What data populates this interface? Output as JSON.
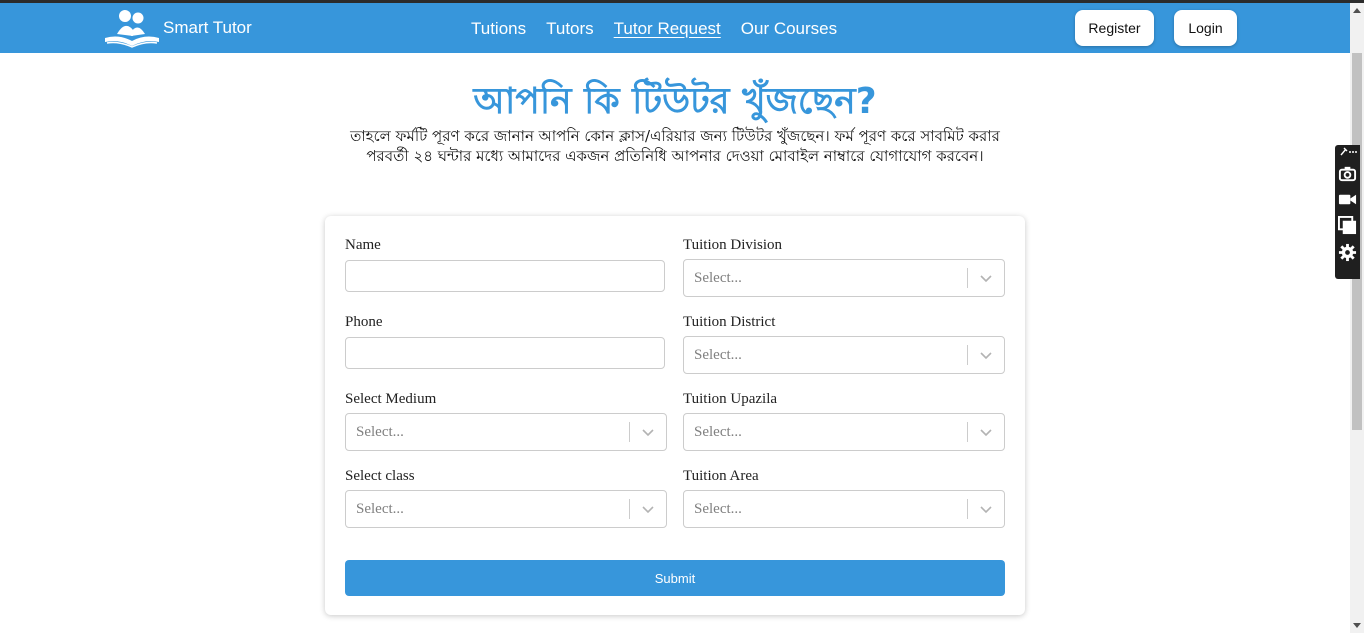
{
  "navbar": {
    "brand_name": "Smart Tutor",
    "links": [
      {
        "label": "Tutions"
      },
      {
        "label": "Tutors"
      },
      {
        "label": "Tutor Request",
        "active": true
      },
      {
        "label": "Our Courses"
      }
    ],
    "register_label": "Register",
    "login_label": "Login",
    "bg_color": "#3796db"
  },
  "main": {
    "heading": "আপনি কি টিউটর খুঁজছেন?",
    "description": "তাহলে ফর্মটি পূরণ করে জানান আপনি কোন ক্লাস/এরিয়ার জন্য টিউটর খুঁজছেন। ফর্ম পূরণ করে সাবমিট করার পরবর্তী ২৪ ঘন্টার মধ্যে আমাদের একজন প্রতিনিধি আপনার দেওয়া মোবাইল নাম্বারে যোগাযোগ করবেন।"
  },
  "form": {
    "name_label": "Name",
    "phone_label": "Phone",
    "medium_label": "Select Medium",
    "class_label": "Select class",
    "division_label": "Tuition Division",
    "district_label": "Tuition District",
    "upazila_label": "Tuition Upazila",
    "area_label": "Tuition Area",
    "select_placeholder": "Select...",
    "submit_label": "Submit"
  },
  "icons": {
    "brand": "reading-students-logo-icon",
    "toolbar": [
      "pin-icon",
      "more-icon",
      "camera-icon",
      "video-icon",
      "window-icon",
      "gear-icon"
    ]
  }
}
